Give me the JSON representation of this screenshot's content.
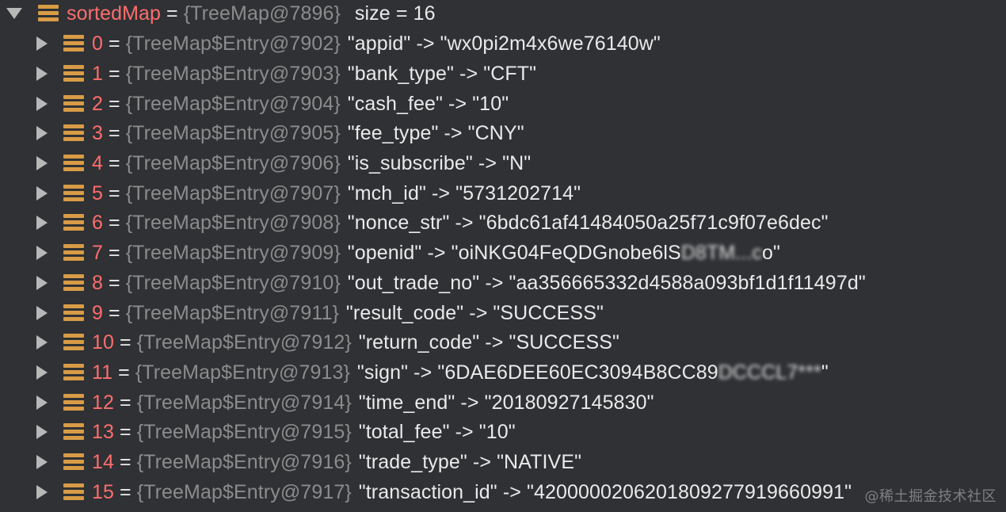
{
  "debug_tree": {
    "root": {
      "name": "sortedMap",
      "type": "{TreeMap@7896}",
      "size_text": "size = 16",
      "toggle_icon": "triangle-down-icon",
      "entry_icon": "field-stack-icon"
    },
    "entries": [
      {
        "index": "0",
        "ref": "{TreeMap$Entry@7902}",
        "value": "\"appid\" -> \"wx0pi2m4x6we76140w\""
      },
      {
        "index": "1",
        "ref": "{TreeMap$Entry@7903}",
        "value": "\"bank_type\" -> \"CFT\""
      },
      {
        "index": "2",
        "ref": "{TreeMap$Entry@7904}",
        "value": "\"cash_fee\" -> \"10\""
      },
      {
        "index": "3",
        "ref": "{TreeMap$Entry@7905}",
        "value": "\"fee_type\" -> \"CNY\""
      },
      {
        "index": "4",
        "ref": "{TreeMap$Entry@7906}",
        "value": "\"is_subscribe\" -> \"N\""
      },
      {
        "index": "5",
        "ref": "{TreeMap$Entry@7907}",
        "value": "\"mch_id\" -> \"5731202714\""
      },
      {
        "index": "6",
        "ref": "{TreeMap$Entry@7908}",
        "value": "\"nonce_str\" -> \"6bdc61af41484050a25f71c9f07e6dec\""
      },
      {
        "index": "7",
        "ref": "{TreeMap$Entry@7909}",
        "value_prefix": "\"openid\" -> \"oiNKG04FeQDGnobe6lS",
        "value_blurred": "D8TM...c",
        "value_suffix": "o\""
      },
      {
        "index": "8",
        "ref": "{TreeMap$Entry@7910}",
        "value": "\"out_trade_no\" -> \"aa356665332d4588a093bf1d1f11497d\""
      },
      {
        "index": "9",
        "ref": "{TreeMap$Entry@7911}",
        "value": "\"result_code\" -> \"SUCCESS\""
      },
      {
        "index": "10",
        "ref": "{TreeMap$Entry@7912}",
        "value": "\"return_code\" -> \"SUCCESS\""
      },
      {
        "index": "11",
        "ref": "{TreeMap$Entry@7913}",
        "value_prefix": "\"sign\" -> \"6DAE6DEE60EC3094B8CC89",
        "value_blurred": "DCCCL7***",
        "value_suffix": "\""
      },
      {
        "index": "12",
        "ref": "{TreeMap$Entry@7914}",
        "value": "\"time_end\" -> \"20180927145830\""
      },
      {
        "index": "13",
        "ref": "{TreeMap$Entry@7915}",
        "value": "\"total_fee\" -> \"10\""
      },
      {
        "index": "14",
        "ref": "{TreeMap$Entry@7916}",
        "value": "\"trade_type\" -> \"NATIVE\""
      },
      {
        "index": "15",
        "ref": "{TreeMap$Entry@7917}",
        "value": "\"transaction_id\" -> \"4200000206201809277919660991\""
      }
    ],
    "entry_toggle_icon": "triangle-right-icon",
    "colors": {
      "background": "#2f3134",
      "name_red": "#ff6d6d",
      "object_gray": "#8c8c8c",
      "icon_orange": "#d89b46"
    }
  },
  "watermark": "@稀土掘金技术社区"
}
